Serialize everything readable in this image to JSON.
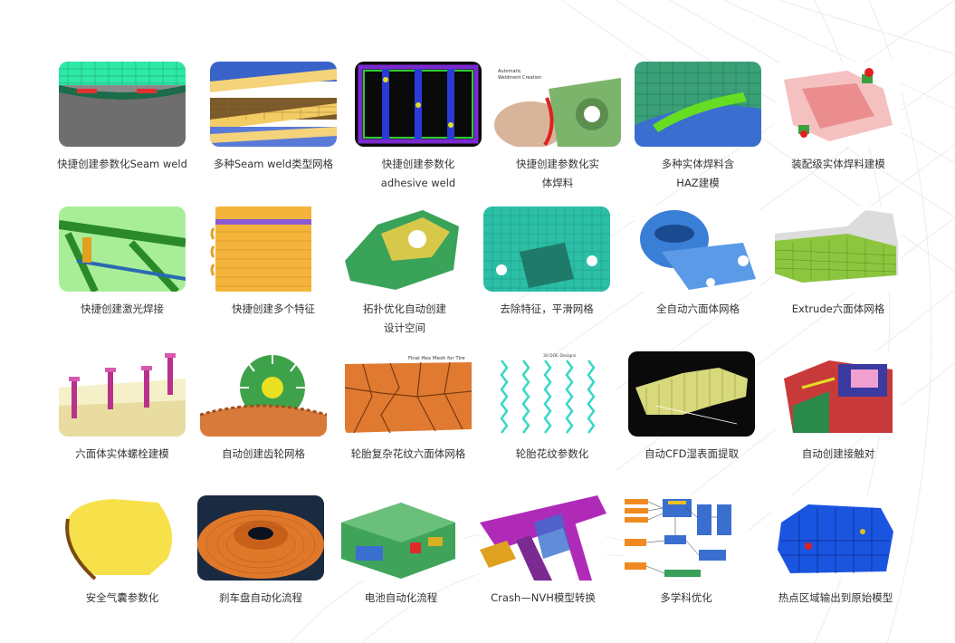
{
  "items": [
    {
      "caption": [
        "快捷创建参数化Seam weld"
      ],
      "colors": {
        "primary": "#2ee8a6",
        "bg": "#6e6e6e"
      }
    },
    {
      "caption": [
        "多种Seam weld类型网格"
      ],
      "colors": {
        "primary": "#f5d37a",
        "bg": "#3a63c9"
      }
    },
    {
      "caption": [
        "快捷创建参数化",
        "adhesive weld"
      ],
      "colors": {
        "primary": "#2b3ad6",
        "bg": "#101010"
      }
    },
    {
      "caption": [
        "快捷创建参数化实",
        "体焊料"
      ],
      "colors": {
        "primary": "#7db46c",
        "bg": "#ffffff"
      },
      "label_text": [
        "Automatic",
        "Weldment Creation"
      ]
    },
    {
      "caption": [
        "多种实体焊料含",
        "HAZ建模"
      ],
      "colors": {
        "primary": "#66dd22",
        "bg": "#3aa078"
      }
    },
    {
      "caption": [
        "装配级实体焊料建模"
      ],
      "colors": {
        "primary": "#e87f7f",
        "bg": "#ffffff"
      }
    },
    {
      "caption": [
        "快捷创建激光焊接"
      ],
      "colors": {
        "primary": "#8fe07a",
        "bg": "#a8ee98"
      }
    },
    {
      "caption": [
        "快捷创建多个特征"
      ],
      "colors": {
        "primary": "#f2b43a",
        "bg": "#ffffff"
      }
    },
    {
      "caption": [
        "拓扑优化自动创建",
        "设计空间"
      ],
      "colors": {
        "primary": "#3aa35a",
        "bg": "#ffffff"
      }
    },
    {
      "caption": [
        "去除特征，平滑网格"
      ],
      "colors": {
        "primary": "#3ce0c0",
        "bg": "#2bbfa6"
      }
    },
    {
      "caption": [
        "全自动六面体网格"
      ],
      "colors": {
        "primary": "#3a7fd6",
        "bg": "#ffffff"
      }
    },
    {
      "caption": [
        "Extrude六面体网格"
      ],
      "colors": {
        "primary": "#8cc63f",
        "bg": "#ffffff"
      }
    },
    {
      "caption": [
        "六面体实体螺栓建模"
      ],
      "colors": {
        "primary": "#b8328c",
        "bg": "#f5f0c8"
      }
    },
    {
      "caption": [
        "自动创建齿轮网格"
      ],
      "colors": {
        "primary": "#3ea24a",
        "bg": "#ffffff"
      }
    },
    {
      "caption": [
        "轮胎复杂花纹六面体网格"
      ],
      "colors": {
        "primary": "#e07a30",
        "bg": "#ffffff"
      },
      "label_text": [
        "Final Hex Mesh for Tire"
      ]
    },
    {
      "caption": [
        "轮胎花纹参数化"
      ],
      "colors": {
        "primary": "#36d8c4",
        "bg": "#ffffff"
      },
      "label_text": [
        "30 DOE Designs"
      ]
    },
    {
      "caption": [
        "自动CFD湿表面提取"
      ],
      "colors": {
        "primary": "#eeee88",
        "bg": "#0a0a0a"
      }
    },
    {
      "caption": [
        "自动创建接触对"
      ],
      "colors": {
        "primary": "#c83a3a",
        "bg": "#ffffff"
      }
    },
    {
      "caption": [
        "安全气囊参数化"
      ],
      "colors": {
        "primary": "#f7e14a",
        "bg": "#ffffff"
      }
    },
    {
      "caption": [
        "刹车盘自动化流程"
      ],
      "colors": {
        "primary": "#e0782a",
        "bg": "#1a2a40"
      }
    },
    {
      "caption": [
        "电池自动化流程"
      ],
      "colors": {
        "primary": "#3fa45a",
        "bg": "#ffffff"
      }
    },
    {
      "caption": [
        "Crash—NVH模型转换"
      ],
      "colors": {
        "primary": "#b02ab8",
        "bg": "#ffffff"
      }
    },
    {
      "caption": [
        "多学科优化"
      ],
      "colors": {
        "primary": "#3a6fd0",
        "bg": "#ffffff"
      }
    },
    {
      "caption": [
        "热点区域输出到原始模型"
      ],
      "colors": {
        "primary": "#1a55e0",
        "bg": "#ffffff"
      }
    }
  ]
}
